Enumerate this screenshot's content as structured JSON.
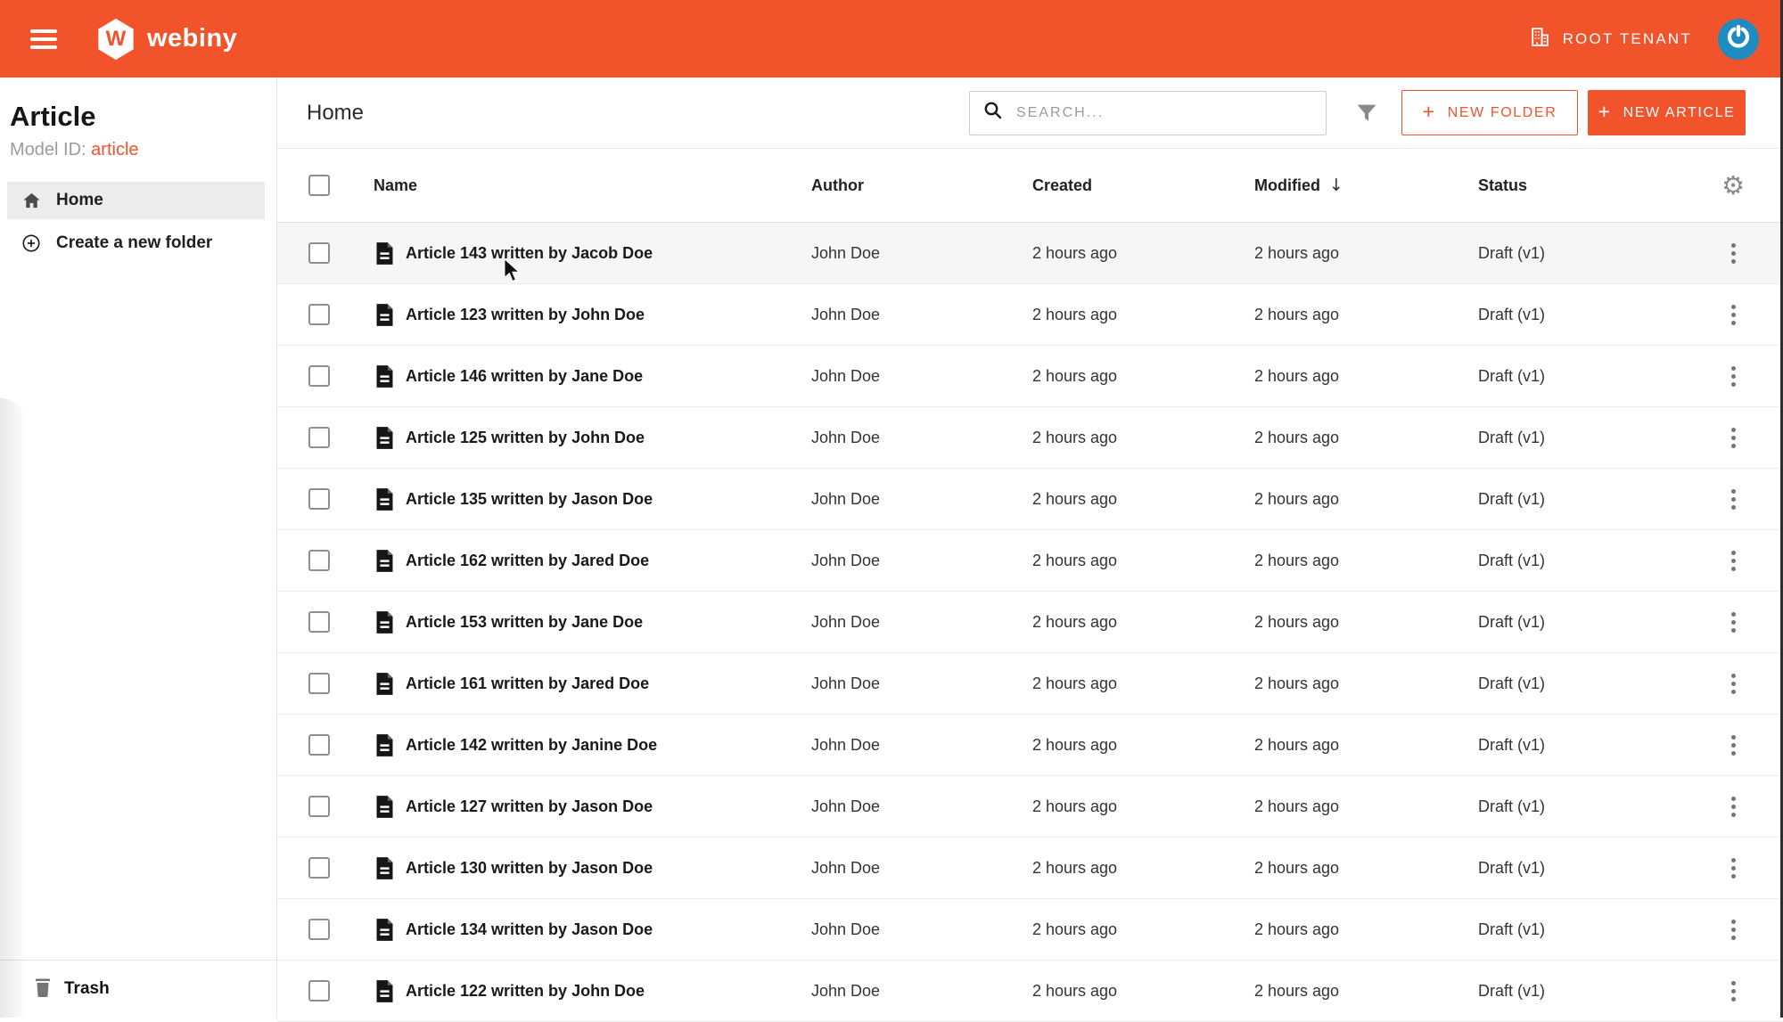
{
  "colors": {
    "accent": "#F1542B",
    "avatar_blue": "#1E8CBE",
    "row_hover": "#F6F6F6"
  },
  "topbar": {
    "brand_wordmark": "webiny",
    "logo_letter": "W",
    "tenant": {
      "icon": "building-icon",
      "label": "ROOT TENANT"
    },
    "avatar_icon": "gravatar-power-icon",
    "menu_icon": "hamburger-icon"
  },
  "sidebar": {
    "title": "Article",
    "model_id": {
      "label": "Model ID:",
      "value": "article"
    },
    "nav": [
      {
        "icon": "home-icon",
        "label": "Home",
        "active": true
      },
      {
        "icon": "plus-circle-icon",
        "label": "Create a new folder",
        "active": false
      }
    ],
    "footer": {
      "icon": "trash-icon",
      "label": "Trash"
    }
  },
  "content_header": {
    "title": "Home",
    "search": {
      "icon": "search-icon",
      "placeholder": "SEARCH..."
    },
    "filter_icon": "filter-icon",
    "buttons": [
      {
        "label": "NEW FOLDER",
        "plus": "+",
        "style": "outlined"
      },
      {
        "label": "NEW ARTICLE",
        "plus": "+",
        "style": "solid"
      }
    ]
  },
  "table": {
    "columns": [
      "Name",
      "Author",
      "Created",
      "Modified",
      "Status"
    ],
    "sort": {
      "column": "Modified",
      "direction": "desc",
      "indicator": "↓"
    },
    "settings_icon": "gear-icon",
    "row_icon": "document-icon",
    "row_menu_icon": "kebab-menu-icon",
    "hovered_row_index": 0,
    "rows": [
      {
        "name": "Article 143 written by Jacob Doe",
        "author": "John Doe",
        "created": "2 hours ago",
        "modified": "2 hours ago",
        "status": "Draft (v1)"
      },
      {
        "name": "Article 123 written by John Doe",
        "author": "John Doe",
        "created": "2 hours ago",
        "modified": "2 hours ago",
        "status": "Draft (v1)"
      },
      {
        "name": "Article 146 written by Jane Doe",
        "author": "John Doe",
        "created": "2 hours ago",
        "modified": "2 hours ago",
        "status": "Draft (v1)"
      },
      {
        "name": "Article 125 written by John Doe",
        "author": "John Doe",
        "created": "2 hours ago",
        "modified": "2 hours ago",
        "status": "Draft (v1)"
      },
      {
        "name": "Article 135 written by Jason Doe",
        "author": "John Doe",
        "created": "2 hours ago",
        "modified": "2 hours ago",
        "status": "Draft (v1)"
      },
      {
        "name": "Article 162 written by Jared Doe",
        "author": "John Doe",
        "created": "2 hours ago",
        "modified": "2 hours ago",
        "status": "Draft (v1)"
      },
      {
        "name": "Article 153 written by Jane Doe",
        "author": "John Doe",
        "created": "2 hours ago",
        "modified": "2 hours ago",
        "status": "Draft (v1)"
      },
      {
        "name": "Article 161 written by Jared Doe",
        "author": "John Doe",
        "created": "2 hours ago",
        "modified": "2 hours ago",
        "status": "Draft (v1)"
      },
      {
        "name": "Article 142 written by Janine Doe",
        "author": "John Doe",
        "created": "2 hours ago",
        "modified": "2 hours ago",
        "status": "Draft (v1)"
      },
      {
        "name": "Article 127 written by Jason Doe",
        "author": "John Doe",
        "created": "2 hours ago",
        "modified": "2 hours ago",
        "status": "Draft (v1)"
      },
      {
        "name": "Article 130 written by Jason Doe",
        "author": "John Doe",
        "created": "2 hours ago",
        "modified": "2 hours ago",
        "status": "Draft (v1)"
      },
      {
        "name": "Article 134 written by Jason Doe",
        "author": "John Doe",
        "created": "2 hours ago",
        "modified": "2 hours ago",
        "status": "Draft (v1)"
      },
      {
        "name": "Article 122 written by John Doe",
        "author": "John Doe",
        "created": "2 hours ago",
        "modified": "2 hours ago",
        "status": "Draft (v1)"
      }
    ]
  }
}
